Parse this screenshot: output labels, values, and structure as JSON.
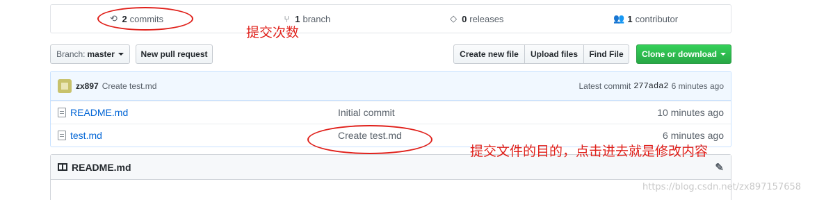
{
  "summary": {
    "commits": {
      "count": "2",
      "label": "commits",
      "icon": "history-icon"
    },
    "branches": {
      "count": "1",
      "label": "branch",
      "icon": "branch-icon"
    },
    "releases": {
      "count": "0",
      "label": "releases",
      "icon": "tag-icon"
    },
    "contributors": {
      "count": "1",
      "label": "contributor",
      "icon": "people-icon"
    }
  },
  "toolbar": {
    "branch_prefix": "Branch:",
    "branch_name": "master",
    "new_pr": "New pull request",
    "create_file": "Create new file",
    "upload_files": "Upload files",
    "find_file": "Find File",
    "clone": "Clone or download"
  },
  "latest_commit": {
    "author": "zx897",
    "message": "Create test.md",
    "prefix": "Latest commit",
    "sha": "277ada2",
    "age": "6 minutes ago"
  },
  "files": [
    {
      "name": "README.md",
      "message": "Initial commit",
      "age": "10 minutes ago"
    },
    {
      "name": "test.md",
      "message": "Create test.md",
      "age": "6 minutes ago"
    }
  ],
  "readme": {
    "title": "README.md"
  },
  "annotations": {
    "commits_note": "提交次数",
    "file_note": "提交文件的目的，点击进去就是修改内容",
    "color": "#e0201a"
  },
  "watermark": "https://blog.csdn.net/zx897157658"
}
